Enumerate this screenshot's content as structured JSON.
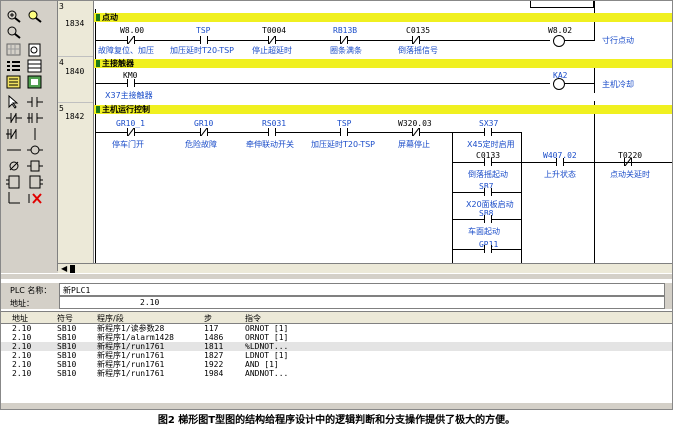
{
  "rungs": [
    {
      "num": "3",
      "addr": "1834",
      "title": "点动"
    },
    {
      "num": "4",
      "addr": "1840",
      "title": "主接触器"
    },
    {
      "num": "5",
      "addr": "1842",
      "title": "主机运行控制"
    }
  ],
  "rung1": {
    "contacts": [
      {
        "addr": "W8.00",
        "label": "故障复位、加压"
      },
      {
        "addr": "TSP",
        "label": "加压延时T20-TSP"
      },
      {
        "addr": "T0004",
        "label": "停止超延时"
      },
      {
        "addr": "RB13B",
        "label": "圈条满条"
      },
      {
        "addr": "C0135",
        "label": "倒落摇信号"
      }
    ],
    "coil": {
      "addr": "W8.02",
      "label": "寸行点动"
    }
  },
  "rung2": {
    "contact": {
      "addr": "KM0",
      "label": "X37主接触器"
    },
    "coil": {
      "addr": "KA2",
      "label": "主机冷却"
    }
  },
  "rung3": {
    "contacts": [
      {
        "addr": "GR10_1",
        "label": "停车门开"
      },
      {
        "addr": "GR10",
        "label": "危险故障"
      },
      {
        "addr": "RS031",
        "label": "牵伸联动开关"
      },
      {
        "addr": "TSP",
        "label": "加压延时T20-TSP"
      },
      {
        "addr": "W320.03",
        "label": "屏幕停止"
      },
      {
        "addr": "SX37",
        "label": "X45定时启用"
      }
    ],
    "branch": [
      {
        "addr": "C0133",
        "label": "倒落摇起动"
      },
      {
        "addr": "SB7",
        "label": "X20面板启动"
      },
      {
        "addr": "SB8",
        "label": "车面起动"
      },
      {
        "addr": "GR11",
        "label": ""
      }
    ],
    "tail": [
      {
        "addr": "W407.02",
        "label": "上升状态"
      },
      {
        "addr": "T0220",
        "label": "点动关延时"
      }
    ]
  },
  "info": {
    "plc_label": "PLC 名称：",
    "plc_value": "新PLC1",
    "addr_label": "地址：",
    "addr_value": "2.10"
  },
  "table": {
    "headers": [
      "地址",
      "符号",
      "程序/段",
      "步",
      "指令"
    ],
    "rows": [
      [
        "2.10",
        "SB10",
        "新程序1/读参数28",
        "117",
        "ORNOT [1]"
      ],
      [
        "2.10",
        "SB10",
        "新程序1/alarm1428",
        "1486",
        "ORNOT [1]"
      ],
      [
        "2.10",
        "SB10",
        "新程序1/run1761",
        "1811",
        "%LDNOT..."
      ],
      [
        "2.10",
        "SB10",
        "新程序1/run1761",
        "1827",
        "LDNOT [1]"
      ],
      [
        "2.10",
        "SB10",
        "新程序1/run1761",
        "1922",
        "AND [1]"
      ],
      [
        "2.10",
        "SB10",
        "新程序1/run1761",
        "1984",
        "ANDNOT..."
      ]
    ],
    "selected_row": 2
  },
  "caption": "图2 梯形图T型图的结构给程序设计中的逻辑判断和分支操作提供了极大的方便。",
  "colors": {
    "banner": "#f0f020",
    "label": "#1b4dc9",
    "panel": "#d4d0c8"
  }
}
